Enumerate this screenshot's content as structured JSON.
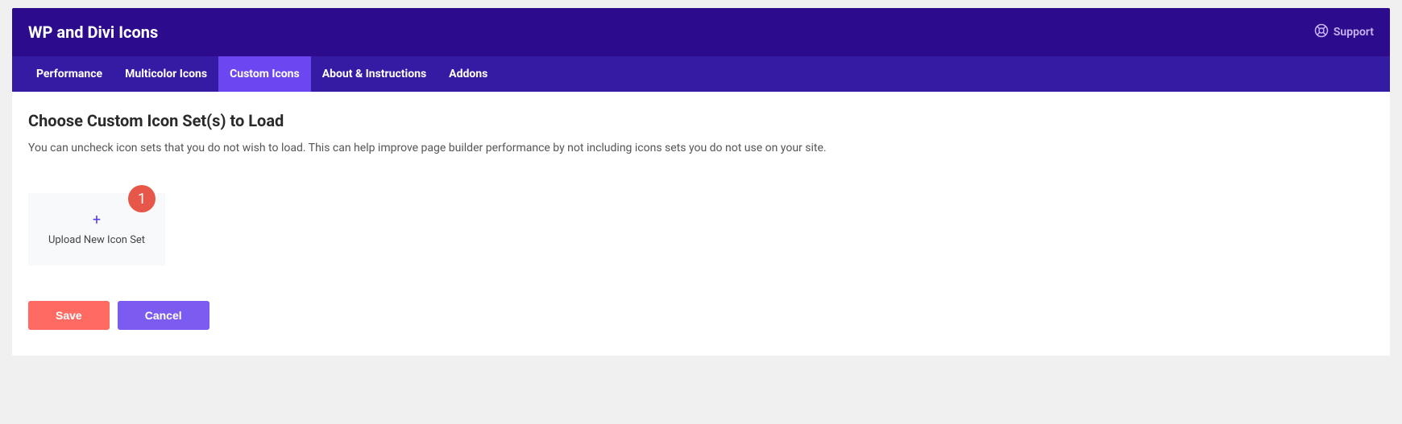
{
  "header": {
    "title": "WP and Divi Icons",
    "support_label": "Support"
  },
  "tabs": [
    {
      "label": "Performance",
      "active": false
    },
    {
      "label": "Multicolor Icons",
      "active": false
    },
    {
      "label": "Custom Icons",
      "active": true
    },
    {
      "label": "About & Instructions",
      "active": false
    },
    {
      "label": "Addons",
      "active": false
    }
  ],
  "content": {
    "title": "Choose Custom Icon Set(s) to Load",
    "description": "You can uncheck icon sets that you do not wish to load. This can help improve page builder performance by not including icons sets you do not use on your site.",
    "upload": {
      "label": "Upload New Icon Set",
      "plus": "+",
      "badge": "1"
    },
    "save_label": "Save",
    "cancel_label": "Cancel"
  }
}
